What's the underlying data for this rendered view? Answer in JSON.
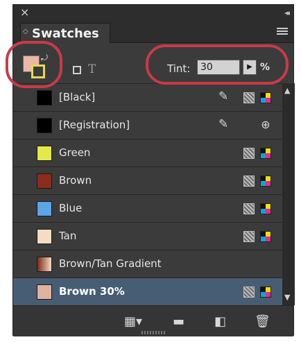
{
  "panel": {
    "title_close": "×",
    "collapse": "◂◂",
    "tab": "Swatches",
    "tab_arrows": "◇"
  },
  "toolbar": {
    "tint_label": "Tint:",
    "tint_value": "30",
    "tint_unit": "%",
    "icon_fill_stroke": "fill-stroke-swatch-icon",
    "icon_container": "formatting-container-icon",
    "icon_text": "formatting-text-icon"
  },
  "swatches": [
    {
      "name": "[Black]",
      "color": "#000000",
      "noedit": true,
      "reg": false,
      "proc": true,
      "cmyk": true
    },
    {
      "name": "[Registration]",
      "color": "#000000",
      "noedit": true,
      "reg": true,
      "proc": false,
      "cmyk": false
    },
    {
      "name": "Green",
      "color": "#e6e84a",
      "noedit": false,
      "reg": false,
      "proc": true,
      "cmyk": true
    },
    {
      "name": "Brown",
      "color": "#8b2c1c",
      "noedit": false,
      "reg": false,
      "proc": true,
      "cmyk": true
    },
    {
      "name": "Blue",
      "color": "#5aa6e6",
      "noedit": false,
      "reg": false,
      "proc": true,
      "cmyk": true
    },
    {
      "name": "Tan",
      "color": "#f6dcc2",
      "noedit": false,
      "reg": false,
      "proc": true,
      "cmyk": true
    },
    {
      "name": "Brown/Tan Gradient",
      "color": "linear-gradient(90deg,#7a2a1a,#f6dcc2)",
      "noedit": false,
      "reg": false,
      "proc": false,
      "cmyk": false
    },
    {
      "name": "Brown 30%",
      "color": "#e0b3a0",
      "noedit": false,
      "reg": false,
      "proc": true,
      "cmyk": true,
      "selected": true
    }
  ],
  "bottom_icons": [
    "show-swatch-kinds-icon",
    "folder-icon",
    "new-swatch-icon",
    "trash-icon"
  ],
  "accent": "#c93b45"
}
